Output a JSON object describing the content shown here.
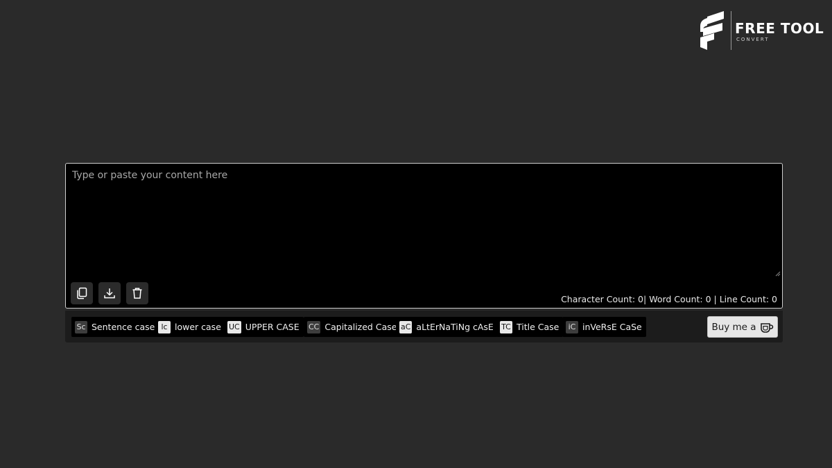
{
  "brand": {
    "title": "FREE TOOL",
    "subtitle": "CONVERT"
  },
  "editor": {
    "placeholder": "Type or paste your content here",
    "value": ""
  },
  "actions": {
    "copy_icon": "copy-icon",
    "download_icon": "download-icon",
    "delete_icon": "trash-icon"
  },
  "counts": {
    "text": "Character Count: 0| Word Count: 0 | Line Count: 0"
  },
  "case_buttons": [
    {
      "badge": "Sc",
      "label": "Sentence case"
    },
    {
      "badge": "lc",
      "label": "lower case"
    },
    {
      "badge": "UC",
      "label": "UPPER CASE"
    },
    {
      "badge": "CC",
      "label": "Capitalized Case"
    },
    {
      "badge": "aC",
      "label": "aLtErNaTiNg cAsE"
    },
    {
      "badge": "TC",
      "label": "Title Case"
    },
    {
      "badge": "iC",
      "label": "inVeRsE CaSe"
    }
  ],
  "coffee": {
    "label": "Buy me a",
    "icon": "coffee-cup-icon"
  },
  "colors": {
    "background": "#2a2a2a",
    "editor": "#000000",
    "toolbar": "#1c1c1c"
  }
}
